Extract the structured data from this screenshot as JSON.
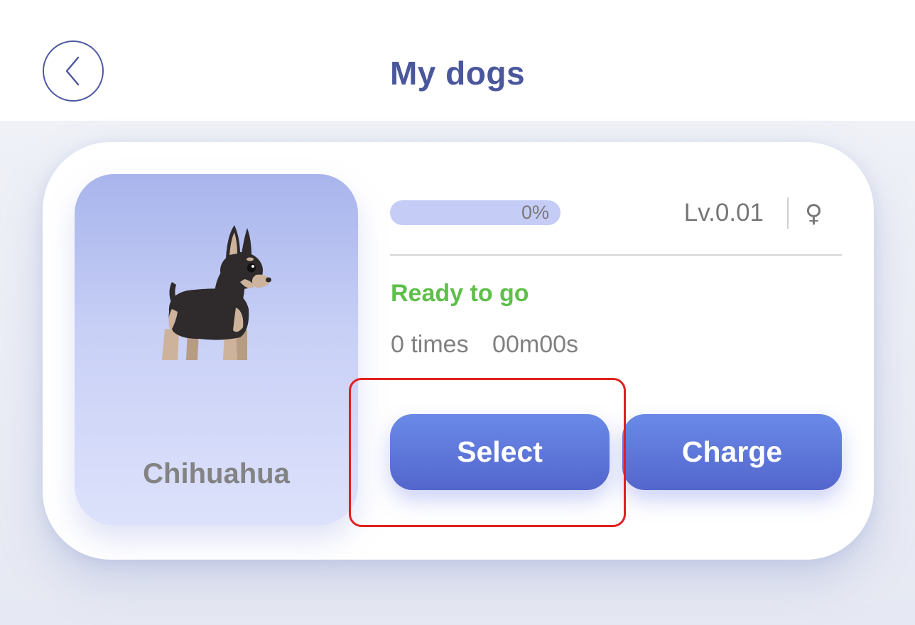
{
  "header": {
    "title": "My dogs",
    "back_icon": "chevron-left-icon"
  },
  "dog": {
    "breed": "Chihuahua",
    "progress": {
      "label": "0%",
      "value": 0
    },
    "level": "Lv.0.01",
    "gender_symbol": "♀",
    "status": "Ready to go",
    "times": "0 times",
    "duration": "00m00s"
  },
  "actions": {
    "select_label": "Select",
    "charge_label": "Charge"
  },
  "colors": {
    "title": "#4a579c",
    "status_ready": "#5ebf4a",
    "button": "#5a74d6",
    "highlight": "#e02020"
  }
}
